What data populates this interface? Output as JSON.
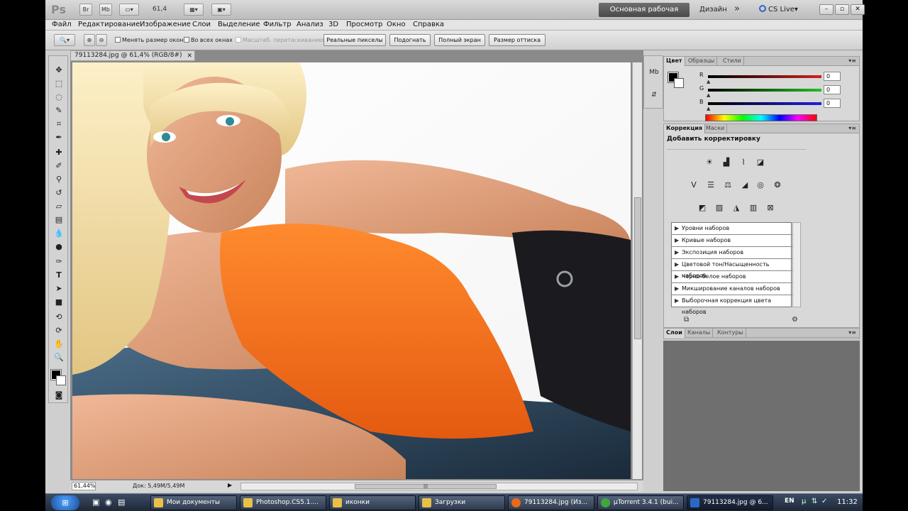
{
  "app": {
    "logo": "Ps",
    "appbar_buttons": [
      "Br",
      "Mb"
    ],
    "zoom_display": "61,4",
    "workspace_active": "Основная рабочая среда",
    "workspace_design": "Дизайн",
    "more": "»",
    "cs_live": "CS Live▾",
    "window_buttons": [
      "–",
      "▫",
      "✕"
    ]
  },
  "menu": [
    "Файл",
    "Редактирование",
    "Изображение",
    "Слои",
    "Выделение",
    "Фильтр",
    "Анализ",
    "3D",
    "Просмотр",
    "Окно",
    "Справка"
  ],
  "options": {
    "resize_windows": "Менять размер окон",
    "all_windows": "Во всех окнах",
    "scrubby_zoom": "Масштаб. перетаскиванием",
    "actual_pixels": "Реальные пикселы",
    "fit_screen": "Подогнать",
    "fill_screen": "Полный экран",
    "print_size": "Размер оттиска"
  },
  "document": {
    "tab_title": "79113284.jpg @ 61,4% (RGB/8#)",
    "close": "✕",
    "zoom": "61,44%",
    "doc_info": "Док: 5,49M/5,49M",
    "hscroll_grip": "|||"
  },
  "tools": [
    "move-tool",
    "marquee-tool",
    "lasso-tool",
    "quick-select-tool",
    "crop-tool",
    "eyedropper-tool",
    "healing-brush-tool",
    "brush-tool",
    "clone-stamp-tool",
    "history-brush-tool",
    "eraser-tool",
    "gradient-tool",
    "blur-tool",
    "dodge-tool",
    "pen-tool",
    "type-tool",
    "path-select-tool",
    "shape-tool",
    "3d-rotate-tool",
    "3d-orbit-tool",
    "hand-tool",
    "zoom-tool"
  ],
  "color_panel": {
    "tabs": [
      "Цвет",
      "Образцы",
      "Стили"
    ],
    "channels": [
      {
        "label": "R",
        "value": "0",
        "color": "#d02020"
      },
      {
        "label": "G",
        "value": "0",
        "color": "#20b020"
      },
      {
        "label": "B",
        "value": "0",
        "color": "#2020d0"
      }
    ]
  },
  "adjust_panel": {
    "tabs": [
      "Коррекция",
      "Маски"
    ],
    "title": "Добавить корректировку",
    "presets": [
      "Уровни наборов",
      "Кривые наборов",
      "Экспозиция наборов",
      "Цветовой тон/Насыщенность наборов",
      "Черно-белое наборов",
      "Микширование каналов наборов",
      "Выборочная коррекция цвета наборов"
    ]
  },
  "layers_panel": {
    "tabs": [
      "Слои",
      "Каналы",
      "Контуры"
    ]
  },
  "panel_menu": "▾≡",
  "taskbar": {
    "items": [
      {
        "label": "Мои документы",
        "color": "#e8c04a"
      },
      {
        "label": "Photoshop.CS5.1....",
        "color": "#e8c04a"
      },
      {
        "label": "иконки",
        "color": "#e8c04a"
      },
      {
        "label": "Загрузки",
        "color": "#e8c04a"
      },
      {
        "label": "79113284.jpg (Из...",
        "color": "#e86a1a"
      },
      {
        "label": "µTorrent 3.4.1  (bui...",
        "color": "#3ea83e"
      },
      {
        "label": "79113284.jpg @ 6...",
        "color": "#2a6ac6"
      }
    ],
    "lang": "EN",
    "clock": "11:32"
  }
}
